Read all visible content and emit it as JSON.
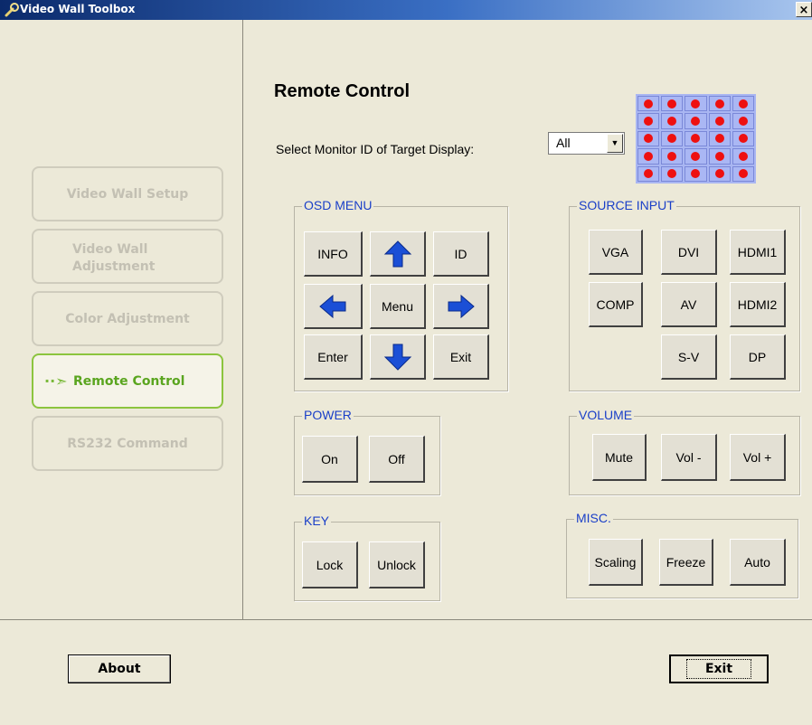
{
  "window": {
    "title": "Video Wall Toolbox",
    "close_glyph": "×"
  },
  "sidebar": {
    "items": [
      {
        "label": "Video Wall Setup",
        "state": "disabled"
      },
      {
        "label": "Video Wall\nAdjustment",
        "state": "disabled"
      },
      {
        "label": "Color Adjustment",
        "state": "disabled"
      },
      {
        "label": "Remote Control",
        "state": "active"
      },
      {
        "label": "RS232 Command",
        "state": "disabled"
      }
    ],
    "active_arrow": "··➣"
  },
  "main": {
    "title": "Remote Control",
    "monitor_select": {
      "label": "Select Monitor ID of Target Display:",
      "value": "All",
      "arrow": "▼"
    },
    "groups": {
      "osd": {
        "title": "OSD MENU",
        "info": "INFO",
        "id": "ID",
        "menu": "Menu",
        "enter": "Enter",
        "exit": "Exit"
      },
      "source": {
        "title": "SOURCE INPUT",
        "vga": "VGA",
        "dvi": "DVI",
        "hdmi1": "HDMI1",
        "comp": "COMP",
        "av": "AV",
        "hdmi2": "HDMI2",
        "sv": "S-V",
        "dp": "DP"
      },
      "power": {
        "title": "POWER",
        "on": "On",
        "off": "Off"
      },
      "volume": {
        "title": "VOLUME",
        "mute": "Mute",
        "down": "Vol -",
        "up": "Vol +"
      },
      "key": {
        "title": "KEY",
        "lock": "Lock",
        "unlock": "Unlock"
      },
      "misc": {
        "title": "MISC.",
        "scaling": "Scaling",
        "freeze": "Freeze",
        "auto": "Auto"
      }
    }
  },
  "footer": {
    "about": "About",
    "exit": "Exit"
  },
  "colors": {
    "group_title": "#1a3fc8",
    "active_nav": "#5aa51f",
    "monitor_dot": "#ee1010",
    "monitor_cell": "#aab7f4",
    "arrow_blue": "#1b4fd6"
  },
  "icons": {
    "up": "arrow-up-icon",
    "down": "arrow-down-icon",
    "left": "arrow-left-icon",
    "right": "arrow-right-icon",
    "app": "wrench-icon"
  }
}
